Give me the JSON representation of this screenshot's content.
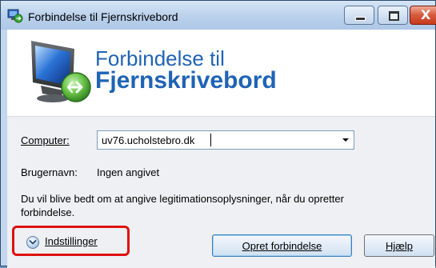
{
  "window": {
    "title": "Forbindelse til Fjernskrivebord",
    "controls": {
      "minimize": "–",
      "maximize": "□",
      "close": "X"
    }
  },
  "banner": {
    "line1": "Forbindelse til",
    "line2": "Fjernskrivebord"
  },
  "form": {
    "computer_label": "Computer:",
    "computer_value": "uv76.ucholstebro.dk",
    "username_label": "Brugernavn:",
    "username_value": "Ingen angivet",
    "notice": "Du vil blive bedt om at angive legitimationsoplysninger, når du opretter forbindelse."
  },
  "footer": {
    "options_label": "Indstillinger",
    "connect_label": "Opret forbindelse",
    "help_label": "Hjælp"
  },
  "colors": {
    "accent_text": "#1f63b6",
    "highlight_border": "#e01010",
    "close_button": "#c63a1c"
  }
}
